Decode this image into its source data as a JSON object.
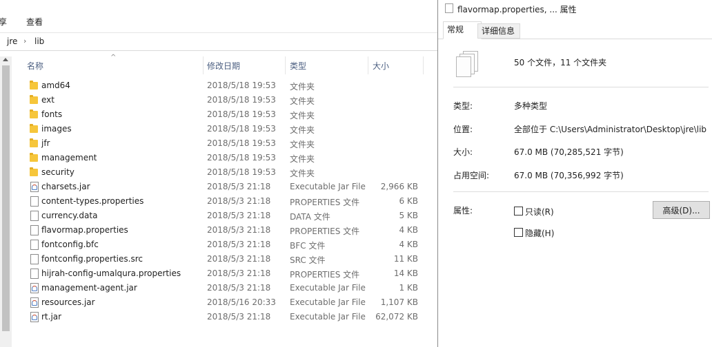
{
  "explorer": {
    "ribbon_tabs": [
      "享",
      "查看"
    ],
    "breadcrumb": [
      "jre",
      "lib"
    ],
    "columns": {
      "name": "名称",
      "date": "修改日期",
      "type": "类型",
      "size": "大小"
    },
    "files": [
      {
        "name": "amd64",
        "date": "2018/5/18 19:53",
        "type": "文件夹",
        "size": "",
        "icon": "folder-icon"
      },
      {
        "name": "ext",
        "date": "2018/5/18 19:53",
        "type": "文件夹",
        "size": "",
        "icon": "folder-icon"
      },
      {
        "name": "fonts",
        "date": "2018/5/18 19:53",
        "type": "文件夹",
        "size": "",
        "icon": "folder-icon"
      },
      {
        "name": "images",
        "date": "2018/5/18 19:53",
        "type": "文件夹",
        "size": "",
        "icon": "folder-icon"
      },
      {
        "name": "jfr",
        "date": "2018/5/18 19:53",
        "type": "文件夹",
        "size": "",
        "icon": "folder-icon"
      },
      {
        "name": "management",
        "date": "2018/5/18 19:53",
        "type": "文件夹",
        "size": "",
        "icon": "folder-icon"
      },
      {
        "name": "security",
        "date": "2018/5/18 19:53",
        "type": "文件夹",
        "size": "",
        "icon": "folder-icon"
      },
      {
        "name": "charsets.jar",
        "date": "2018/5/3 21:18",
        "type": "Executable Jar File",
        "size": "2,966 KB",
        "icon": "jar-icon"
      },
      {
        "name": "content-types.properties",
        "date": "2018/5/3 21:18",
        "type": "PROPERTIES 文件",
        "size": "6 KB",
        "icon": "file-icon"
      },
      {
        "name": "currency.data",
        "date": "2018/5/3 21:18",
        "type": "DATA 文件",
        "size": "5 KB",
        "icon": "file-icon"
      },
      {
        "name": "flavormap.properties",
        "date": "2018/5/3 21:18",
        "type": "PROPERTIES 文件",
        "size": "4 KB",
        "icon": "file-icon"
      },
      {
        "name": "fontconfig.bfc",
        "date": "2018/5/3 21:18",
        "type": "BFC 文件",
        "size": "4 KB",
        "icon": "file-icon"
      },
      {
        "name": "fontconfig.properties.src",
        "date": "2018/5/3 21:18",
        "type": "SRC 文件",
        "size": "11 KB",
        "icon": "file-icon"
      },
      {
        "name": "hijrah-config-umalqura.properties",
        "date": "2018/5/3 21:18",
        "type": "PROPERTIES 文件",
        "size": "14 KB",
        "icon": "file-icon"
      },
      {
        "name": "management-agent.jar",
        "date": "2018/5/3 21:18",
        "type": "Executable Jar File",
        "size": "1 KB",
        "icon": "jar-icon"
      },
      {
        "name": "resources.jar",
        "date": "2018/5/16 20:33",
        "type": "Executable Jar File",
        "size": "1,107 KB",
        "icon": "jar-icon"
      },
      {
        "name": "rt.jar",
        "date": "2018/5/3 21:18",
        "type": "Executable Jar File",
        "size": "62,072 KB",
        "icon": "jar-icon"
      }
    ]
  },
  "properties": {
    "title": "flavormap.properties, ... 属性",
    "tabs": [
      "常规",
      "详细信息"
    ],
    "summary": "50 个文件，11 个文件夹",
    "type_label": "类型:",
    "type_value": "多种类型",
    "location_label": "位置:",
    "location_value": "全部位于 C:\\Users\\Administrator\\Desktop\\jre\\lib",
    "size_label": "大小:",
    "size_value": "67.0 MB (70,285,521 字节)",
    "disk_label": "占用空间:",
    "disk_value": "67.0 MB (70,356,992 字节)",
    "attributes_label": "属性:",
    "readonly_label": "只读(R)",
    "hidden_label": "隐藏(H)",
    "advanced_label": "高级(D)..."
  }
}
